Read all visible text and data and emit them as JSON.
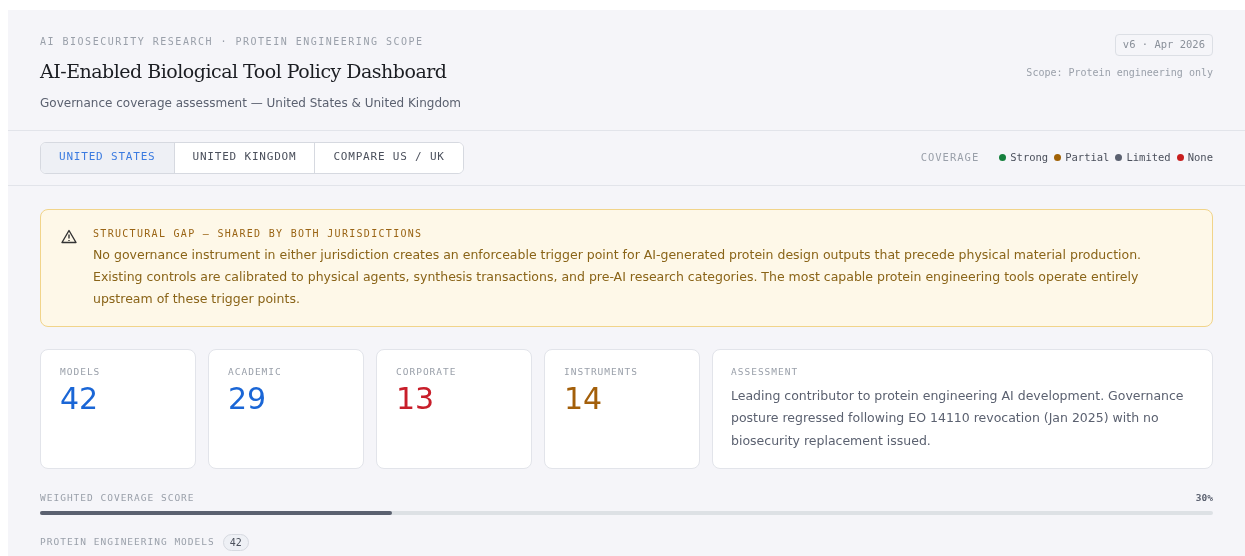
{
  "header": {
    "eyebrow": "AI BIOSECURITY RESEARCH · PROTEIN ENGINEERING SCOPE",
    "title": "AI-Enabled Biological Tool Policy Dashboard",
    "subtitle": "Governance coverage assessment — United States & United Kingdom",
    "version": "v6 · Apr 2026",
    "scope": "Scope: Protein engineering only"
  },
  "tabs": [
    {
      "label": "UNITED STATES",
      "selected": true
    },
    {
      "label": "UNITED KINGDOM",
      "selected": false
    },
    {
      "label": "COMPARE US / UK",
      "selected": false
    }
  ],
  "legend": {
    "title": "COVERAGE",
    "items": [
      {
        "label": "Strong",
        "color": "#15803d"
      },
      {
        "label": "Partial",
        "color": "#a16207"
      },
      {
        "label": "Limited",
        "color": "#5b6170"
      },
      {
        "label": "None",
        "color": "#c81e1e"
      }
    ]
  },
  "alert": {
    "title": "STRUCTURAL GAP — SHARED BY BOTH JURISDICTIONS",
    "text": "No governance instrument in either jurisdiction creates an enforceable trigger point for AI-generated protein design outputs that precede physical material production. Existing controls are calibrated to physical agents, synthesis transactions, and pre-AI research categories. The most capable protein engineering tools operate entirely upstream of these trigger points."
  },
  "stats": [
    {
      "label": "MODELS",
      "value": "42",
      "color": "#1a66d6"
    },
    {
      "label": "ACADEMIC",
      "value": "29",
      "color": "#1a66d6"
    },
    {
      "label": "CORPORATE",
      "value": "13",
      "color": "#c81e2a"
    },
    {
      "label": "INSTRUMENTS",
      "value": "14",
      "color": "#a35f0a"
    }
  ],
  "assessment": {
    "label": "ASSESSMENT",
    "text": "Leading contributor to protein engineering AI development. Governance posture regressed following EO 14110 revocation (Jan 2025) with no biosecurity replacement issued."
  },
  "score": {
    "label": "WEIGHTED COVERAGE SCORE",
    "reading": "30%",
    "level": 0.3
  },
  "models_section": {
    "label": "PROTEIN ENGINEERING MODELS",
    "count": "42"
  }
}
